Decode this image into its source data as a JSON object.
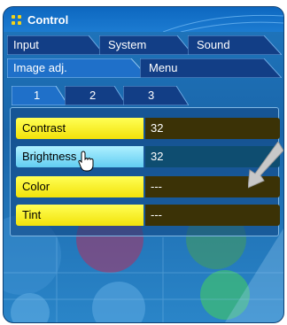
{
  "window": {
    "title": "Control"
  },
  "main_tabs": [
    {
      "label": "Input"
    },
    {
      "label": "System"
    },
    {
      "label": "Sound"
    }
  ],
  "sub_tabs": [
    {
      "label": "Image adj."
    },
    {
      "label": "Menu"
    }
  ],
  "page_tabs": [
    {
      "label": "1"
    },
    {
      "label": "2"
    },
    {
      "label": "3"
    }
  ],
  "settings": [
    {
      "label": "Contrast",
      "value": "32"
    },
    {
      "label": "Brightness",
      "value": "32"
    },
    {
      "label": "Color",
      "value": "---"
    },
    {
      "label": "Tint",
      "value": "---"
    }
  ],
  "colors": {
    "title_bar": "#1c7bd1",
    "item_label": "#f2e20a",
    "item_label_hover": "#62cdf2",
    "item_value": "#3b3206",
    "item_value_hover": "#0e4d70",
    "tab": "#123e86",
    "tab_active": "#1f70c9"
  }
}
